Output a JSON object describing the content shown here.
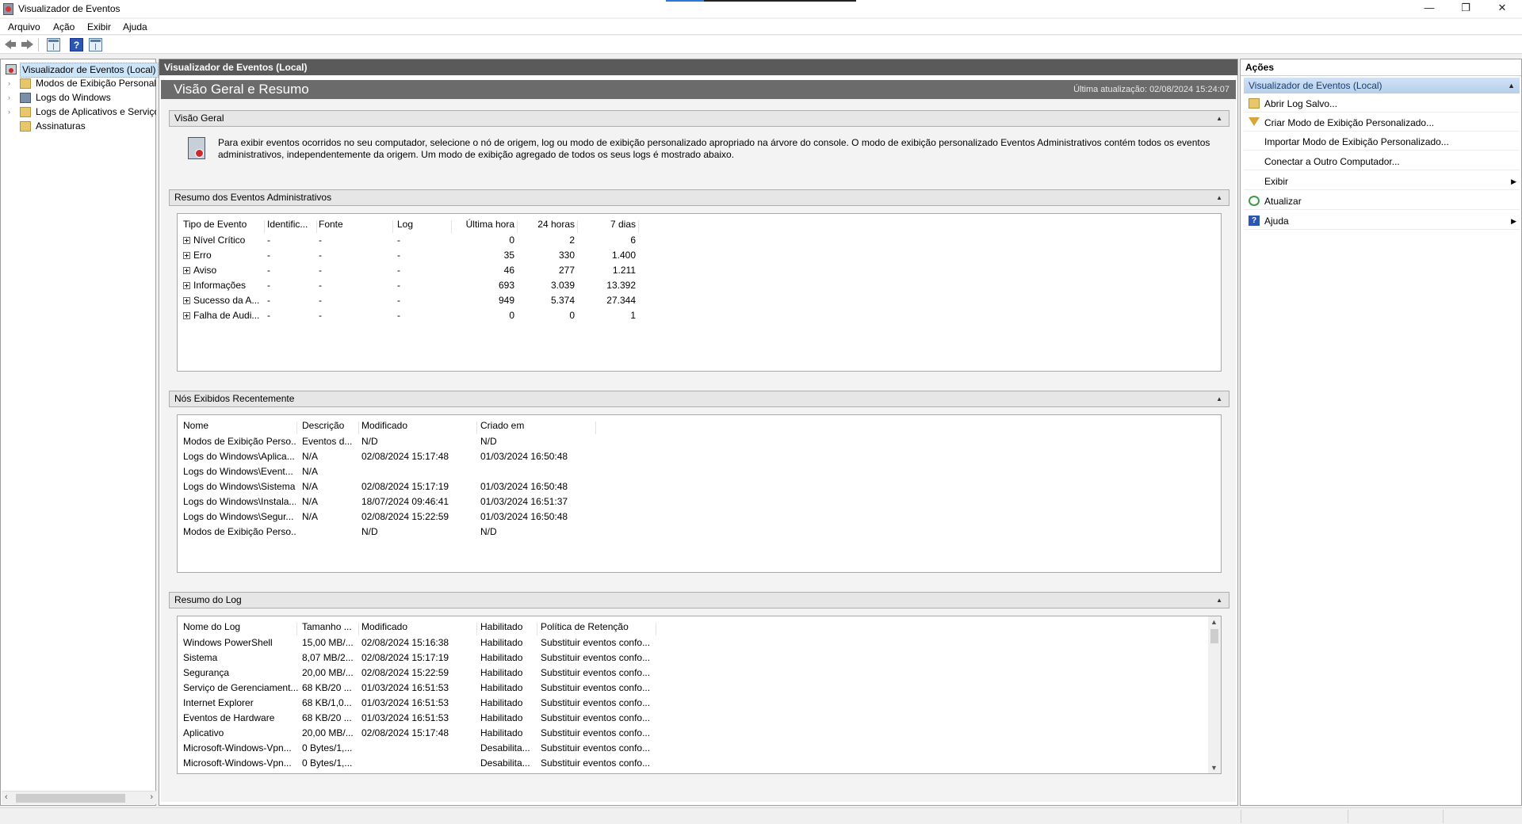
{
  "window": {
    "title": "Visualizador de Eventos",
    "controls": {
      "minimize": "—",
      "maximize": "❐",
      "close": "✕"
    }
  },
  "menu": [
    "Arquivo",
    "Ação",
    "Exibir",
    "Ajuda"
  ],
  "toolbar": {
    "icons": [
      "back-arrow-icon",
      "forward-arrow-icon",
      "show-hide-tree-icon",
      "help-icon",
      "show-hide-action-pane-icon"
    ],
    "help_glyph": "?"
  },
  "tree": {
    "items": [
      {
        "label": "Visualizador de Eventos (Local)",
        "selected": true
      },
      {
        "label": "Modos de Exibição Personali"
      },
      {
        "label": "Logs do Windows"
      },
      {
        "label": "Logs de Aplicativos e Serviço"
      },
      {
        "label": "Assinaturas"
      }
    ]
  },
  "center": {
    "header": "Visualizador de Eventos (Local)",
    "banner_title": "Visão Geral e Resumo",
    "last_update": "Última atualização: 02/08/2024 15:24:07",
    "overview": {
      "title": "Visão Geral",
      "text": "Para exibir eventos ocorridos no seu computador, selecione o nó de origem, log ou modo de exibição personalizado apropriado na árvore do console. O modo de exibição personalizado Eventos Administrativos contém todos os eventos administrativos, independentemente da origem. Um modo de exibição agregado de todos os seus logs é mostrado abaixo."
    },
    "admin_summary": {
      "title": "Resumo dos Eventos Administrativos",
      "columns": [
        "Tipo de Evento",
        "Identific...",
        "Fonte",
        "Log",
        "Última hora",
        "24 horas",
        "7 dias"
      ],
      "rows": [
        [
          "Nível Crítico",
          "-",
          "-",
          "-",
          "0",
          "2",
          "6"
        ],
        [
          "Erro",
          "-",
          "-",
          "-",
          "35",
          "330",
          "1.400"
        ],
        [
          "Aviso",
          "-",
          "-",
          "-",
          "46",
          "277",
          "1.211"
        ],
        [
          "Informações",
          "-",
          "-",
          "-",
          "693",
          "3.039",
          "13.392"
        ],
        [
          "Sucesso da A...",
          "-",
          "-",
          "-",
          "949",
          "5.374",
          "27.344"
        ],
        [
          "Falha de Audi...",
          "-",
          "-",
          "-",
          "0",
          "0",
          "1"
        ]
      ]
    },
    "recent_nodes": {
      "title": "Nós Exibidos Recentemente",
      "columns": [
        "Nome",
        "Descrição",
        "Modificado",
        "Criado em"
      ],
      "rows": [
        [
          "Modos de Exibição Perso...",
          "Eventos d...",
          "N/D",
          "N/D"
        ],
        [
          "Logs do Windows\\Aplica...",
          "N/A",
          "02/08/2024 15:17:48",
          "01/03/2024 16:50:48"
        ],
        [
          "Logs do Windows\\Event...",
          "N/A",
          "",
          ""
        ],
        [
          "Logs do Windows\\Sistema",
          "N/A",
          "02/08/2024 15:17:19",
          "01/03/2024 16:50:48"
        ],
        [
          "Logs do Windows\\Instala...",
          "N/A",
          "18/07/2024 09:46:41",
          "01/03/2024 16:51:37"
        ],
        [
          "Logs do Windows\\Segur...",
          "N/A",
          "02/08/2024 15:22:59",
          "01/03/2024 16:50:48"
        ],
        [
          "Modos de Exibição Perso...",
          "",
          "N/D",
          "N/D"
        ]
      ]
    },
    "log_summary": {
      "title": "Resumo do Log",
      "columns": [
        "Nome do Log",
        "Tamanho ...",
        "Modificado",
        "Habilitado",
        "Política de Retenção"
      ],
      "rows": [
        [
          "Windows PowerShell",
          "15,00 MB/...",
          "02/08/2024 15:16:38",
          "Habilitado",
          "Substituir eventos confo..."
        ],
        [
          "Sistema",
          "8,07 MB/2...",
          "02/08/2024 15:17:19",
          "Habilitado",
          "Substituir eventos confo..."
        ],
        [
          "Segurança",
          "20,00 MB/...",
          "02/08/2024 15:22:59",
          "Habilitado",
          "Substituir eventos confo..."
        ],
        [
          "Serviço de Gerenciament...",
          "68 KB/20 ...",
          "01/03/2024 16:51:53",
          "Habilitado",
          "Substituir eventos confo..."
        ],
        [
          "Internet Explorer",
          "68 KB/1,0...",
          "01/03/2024 16:51:53",
          "Habilitado",
          "Substituir eventos confo..."
        ],
        [
          "Eventos de Hardware",
          "68 KB/20 ...",
          "01/03/2024 16:51:53",
          "Habilitado",
          "Substituir eventos confo..."
        ],
        [
          "Aplicativo",
          "20,00 MB/...",
          "02/08/2024 15:17:48",
          "Habilitado",
          "Substituir eventos confo..."
        ],
        [
          "Microsoft-Windows-Vpn...",
          "0 Bytes/1,...",
          "",
          "Desabilita...",
          "Substituir eventos confo..."
        ],
        [
          "Microsoft-Windows-Vpn...",
          "0 Bytes/1,...",
          "",
          "Desabilita...",
          "Substituir eventos confo..."
        ]
      ]
    }
  },
  "actions": {
    "title": "Ações",
    "section": "Visualizador de Eventos (Local)",
    "items": [
      {
        "label": "Abrir Log Salvo...",
        "icon": "open-log-icon"
      },
      {
        "label": "Criar Modo de Exibição Personalizado...",
        "icon": "filter-icon"
      },
      {
        "label": "Importar Modo de Exibição Personalizado...",
        "icon": ""
      },
      {
        "label": "Conectar a Outro Computador...",
        "icon": ""
      },
      {
        "label": "Exibir",
        "icon": "",
        "submenu": true
      },
      {
        "label": "Atualizar",
        "icon": "refresh-icon"
      },
      {
        "label": "Ajuda",
        "icon": "help-icon",
        "submenu": true
      }
    ]
  }
}
